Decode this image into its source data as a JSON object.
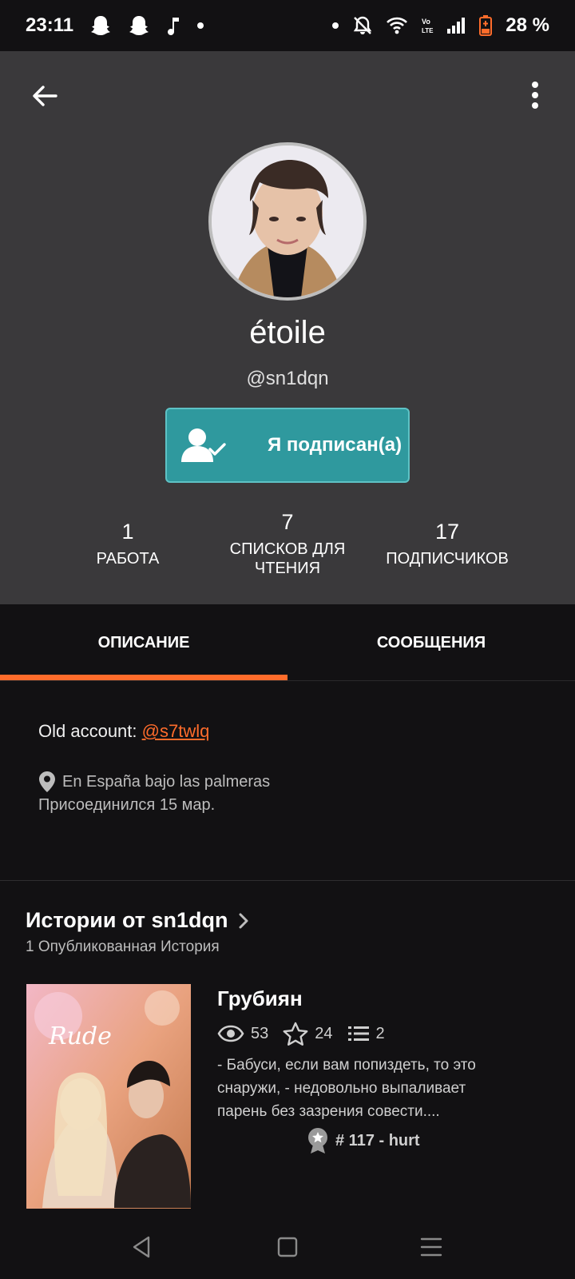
{
  "status_bar": {
    "time": "23:11",
    "battery": "28 %",
    "icons": [
      "snapchat-icon",
      "snapchat-icon",
      "music-note-icon",
      "dot-icon",
      "dot-icon",
      "bell-off-icon",
      "wifi-icon",
      "volte-icon",
      "signal-icon",
      "battery-icon"
    ]
  },
  "profile": {
    "display_name": "étoile",
    "username": "@sn1dqn",
    "follow_button_label": "Я подписан(а)"
  },
  "stats": [
    {
      "number": "1",
      "label": "РАБОТА"
    },
    {
      "number": "7",
      "label_line1": "СПИСКОВ ДЛЯ",
      "label_line2": "ЧТЕНИЯ"
    },
    {
      "number": "17",
      "label": "ПОДПИСЧИКОВ"
    }
  ],
  "tabs": {
    "about": "ОПИСАНИЕ",
    "messages": "СООБЩЕНИЯ",
    "active": "about"
  },
  "about": {
    "old_account_label": "Old account: ",
    "old_account_link": "@s7twlq",
    "location": "En España bajo las palmeras",
    "joined": "Присоединился 15 мар."
  },
  "stories": {
    "title": "Истории от sn1dqn",
    "subtitle": "1 Опубликованная История",
    "items": [
      {
        "title": "Грубиян",
        "reads": "53",
        "votes": "24",
        "parts": "2",
        "description_line1": "- Бабуси, если вам попиздеть, то это",
        "description_line2": "снаружи, - недовольно выпаливает",
        "description_line3": "парень без зазрения совести....",
        "rank": "# 117 - hurt"
      }
    ]
  },
  "colors": {
    "accent": "#ff6c2b",
    "follow_button": "#2f999e",
    "header_bg": "#3a393b",
    "page_bg": "#121113"
  }
}
